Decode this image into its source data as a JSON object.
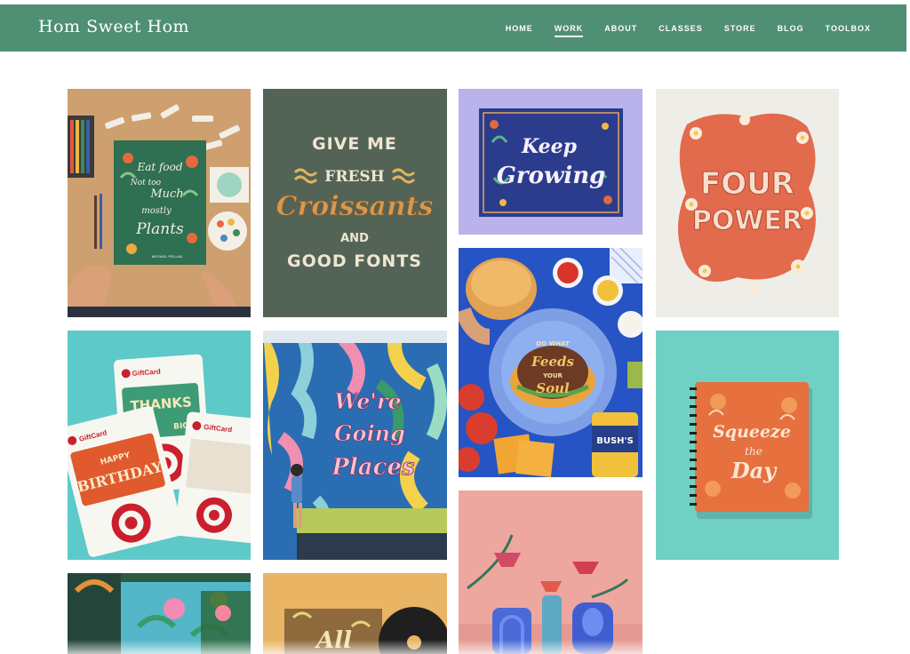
{
  "site": {
    "brand": "Hom Sweet Hom"
  },
  "nav": {
    "items": [
      {
        "label": "HOME",
        "active": false
      },
      {
        "label": "WORK",
        "active": true
      },
      {
        "label": "ABOUT",
        "active": false
      },
      {
        "label": "CLASSES",
        "active": false
      },
      {
        "label": "STORE",
        "active": false
      },
      {
        "label": "BLOG",
        "active": false
      },
      {
        "label": "TOOLBOX",
        "active": false
      }
    ]
  },
  "colors": {
    "header": "#4f8f73",
    "accent": "#ffffff"
  },
  "gallery": {
    "tile1": {
      "lines": [
        "Eat food",
        "Not too",
        "Much",
        "mostly",
        "Plants"
      ],
      "credit": "MICHAEL POLLAN"
    },
    "tile2": {
      "line1": "GIVE ME",
      "line2": "FRESH",
      "line3": "Croissants",
      "line4": "AND",
      "line5": "GOOD FONTS"
    },
    "tile3": {
      "line1": "Keep",
      "line2": "Growing"
    },
    "tile4": {
      "line1": "FOUR",
      "line2": "POWER"
    },
    "tile5": {
      "line1": "DO WHAT",
      "line2": "Feeds",
      "line3": "YOUR",
      "line4": "Soul",
      "can": "BUSH'S"
    },
    "tile6": {
      "brand1": "GiftCard",
      "brand2": "GiftCard",
      "brand3": "GiftCard",
      "line1": "THANKS",
      "line2": "BIG",
      "line3": "HAPPY",
      "line4": "BIRTHDAY"
    },
    "tile7": {
      "line1": "We're",
      "line2": "Going",
      "line3": "Places"
    },
    "tile8": {
      "line1": "Squeeze",
      "line2": "the",
      "line3": "Day"
    },
    "tile10": {
      "line1": "All"
    }
  }
}
